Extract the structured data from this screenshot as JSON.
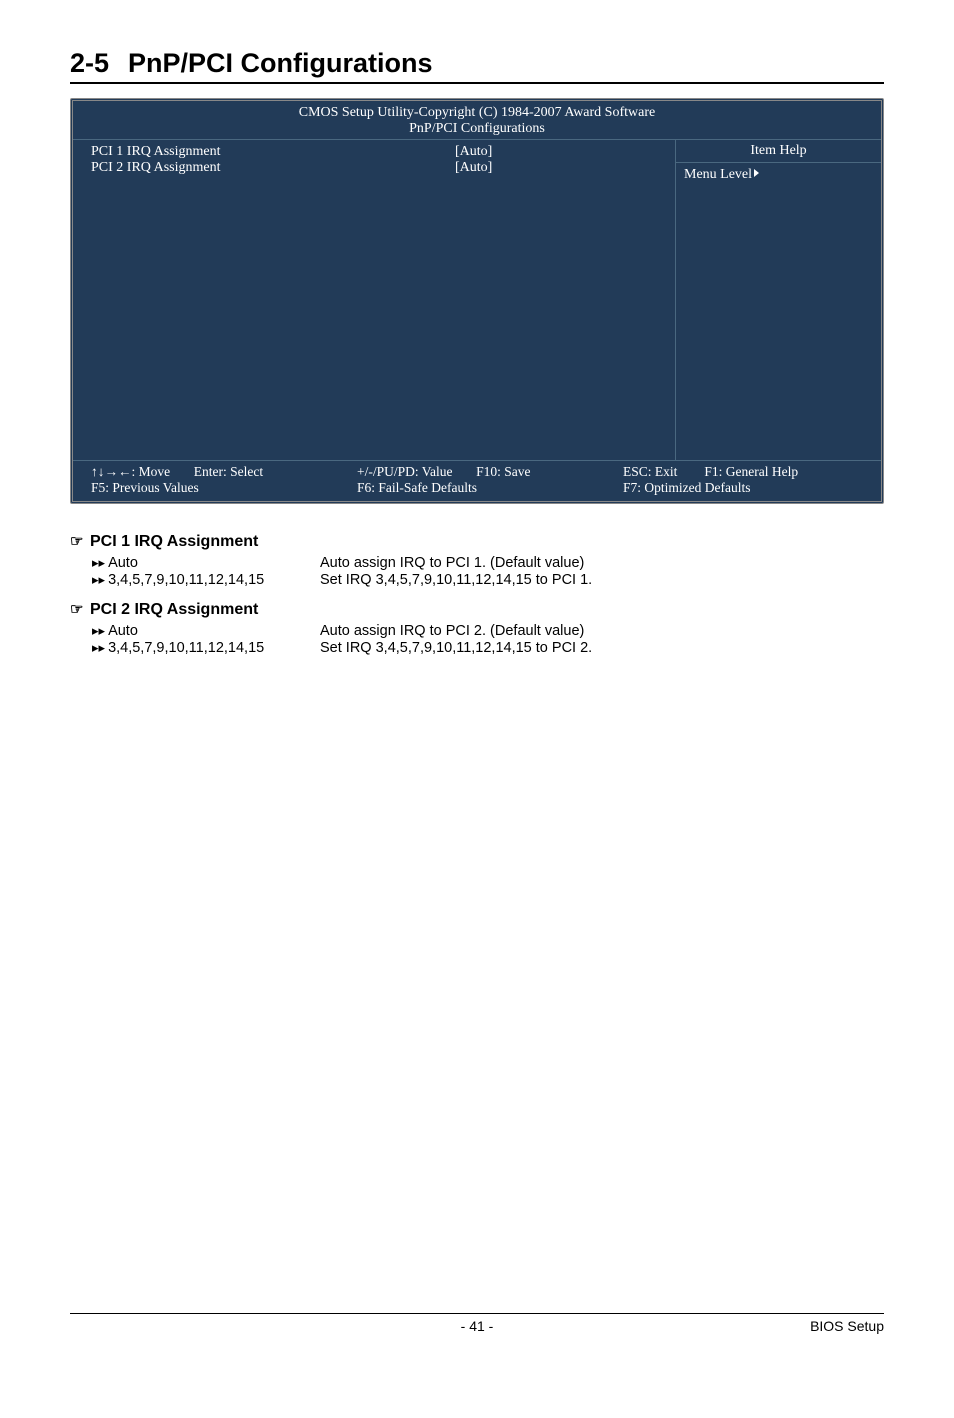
{
  "section": {
    "number": "2-5",
    "title": "PnP/PCI Configurations"
  },
  "bios": {
    "header_line1": "CMOS Setup Utility-Copyright (C) 1984-2007 Award Software",
    "header_line2": "PnP/PCI Configurations",
    "rows": [
      {
        "label": "PCI 1 IRQ Assignment",
        "value": "[Auto]"
      },
      {
        "label": "PCI 2 IRQ Assignment",
        "value": "[Auto]"
      }
    ],
    "help_title": "Item Help",
    "help_body": "Menu Level",
    "footer": {
      "move": "↑↓→←: Move",
      "enter": "Enter: Select",
      "prev": "F5: Previous Values",
      "value": "+/-/PU/PD: Value",
      "failsafe": "F6: Fail-Safe Defaults",
      "save": "F10: Save",
      "esc": "ESC: Exit",
      "general": "F1: General Help",
      "optimized": "F7: Optimized Defaults"
    }
  },
  "opts": {
    "pci1": {
      "heading": "PCI 1 IRQ Assignment",
      "auto_label": "Auto",
      "auto_desc": "Auto assign IRQ to PCI 1. (Default value)",
      "list_label": "3,4,5,7,9,10,11,12,14,15",
      "list_desc": "Set IRQ 3,4,5,7,9,10,11,12,14,15 to PCI 1."
    },
    "pci2": {
      "heading": "PCI 2 IRQ Assignment",
      "auto_label": "Auto",
      "auto_desc": "Auto assign IRQ to PCI 2. (Default value)",
      "list_label": "3,4,5,7,9,10,11,12,14,15",
      "list_desc": "Set IRQ 3,4,5,7,9,10,11,12,14,15 to PCI 2."
    }
  },
  "footer": {
    "page": "- 41 -",
    "right": "BIOS Setup"
  }
}
